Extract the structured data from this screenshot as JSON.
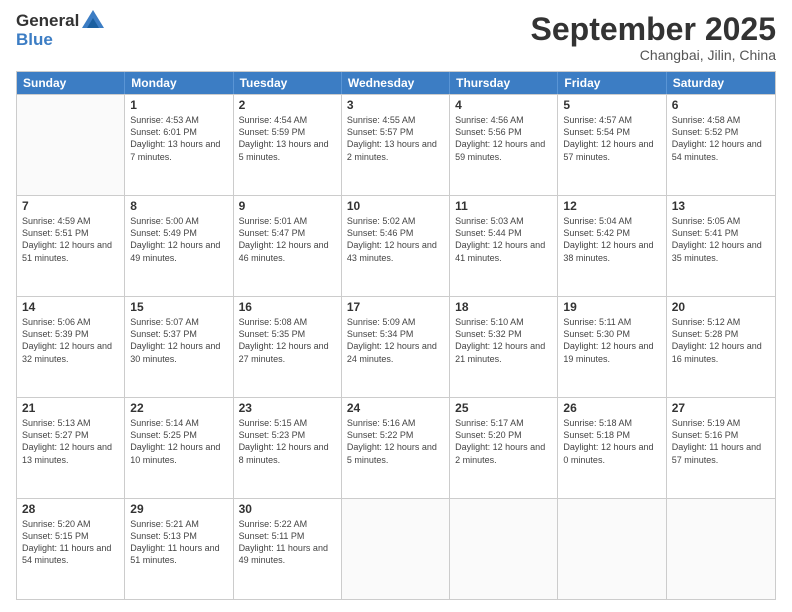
{
  "header": {
    "logo_general": "General",
    "logo_blue": "Blue",
    "month": "September 2025",
    "location": "Changbai, Jilin, China"
  },
  "days": [
    "Sunday",
    "Monday",
    "Tuesday",
    "Wednesday",
    "Thursday",
    "Friday",
    "Saturday"
  ],
  "weeks": [
    [
      {
        "day": "",
        "sunrise": "",
        "sunset": "",
        "daylight": ""
      },
      {
        "day": "1",
        "sunrise": "Sunrise: 4:53 AM",
        "sunset": "Sunset: 6:01 PM",
        "daylight": "Daylight: 13 hours and 7 minutes."
      },
      {
        "day": "2",
        "sunrise": "Sunrise: 4:54 AM",
        "sunset": "Sunset: 5:59 PM",
        "daylight": "Daylight: 13 hours and 5 minutes."
      },
      {
        "day": "3",
        "sunrise": "Sunrise: 4:55 AM",
        "sunset": "Sunset: 5:57 PM",
        "daylight": "Daylight: 13 hours and 2 minutes."
      },
      {
        "day": "4",
        "sunrise": "Sunrise: 4:56 AM",
        "sunset": "Sunset: 5:56 PM",
        "daylight": "Daylight: 12 hours and 59 minutes."
      },
      {
        "day": "5",
        "sunrise": "Sunrise: 4:57 AM",
        "sunset": "Sunset: 5:54 PM",
        "daylight": "Daylight: 12 hours and 57 minutes."
      },
      {
        "day": "6",
        "sunrise": "Sunrise: 4:58 AM",
        "sunset": "Sunset: 5:52 PM",
        "daylight": "Daylight: 12 hours and 54 minutes."
      }
    ],
    [
      {
        "day": "7",
        "sunrise": "Sunrise: 4:59 AM",
        "sunset": "Sunset: 5:51 PM",
        "daylight": "Daylight: 12 hours and 51 minutes."
      },
      {
        "day": "8",
        "sunrise": "Sunrise: 5:00 AM",
        "sunset": "Sunset: 5:49 PM",
        "daylight": "Daylight: 12 hours and 49 minutes."
      },
      {
        "day": "9",
        "sunrise": "Sunrise: 5:01 AM",
        "sunset": "Sunset: 5:47 PM",
        "daylight": "Daylight: 12 hours and 46 minutes."
      },
      {
        "day": "10",
        "sunrise": "Sunrise: 5:02 AM",
        "sunset": "Sunset: 5:46 PM",
        "daylight": "Daylight: 12 hours and 43 minutes."
      },
      {
        "day": "11",
        "sunrise": "Sunrise: 5:03 AM",
        "sunset": "Sunset: 5:44 PM",
        "daylight": "Daylight: 12 hours and 41 minutes."
      },
      {
        "day": "12",
        "sunrise": "Sunrise: 5:04 AM",
        "sunset": "Sunset: 5:42 PM",
        "daylight": "Daylight: 12 hours and 38 minutes."
      },
      {
        "day": "13",
        "sunrise": "Sunrise: 5:05 AM",
        "sunset": "Sunset: 5:41 PM",
        "daylight": "Daylight: 12 hours and 35 minutes."
      }
    ],
    [
      {
        "day": "14",
        "sunrise": "Sunrise: 5:06 AM",
        "sunset": "Sunset: 5:39 PM",
        "daylight": "Daylight: 12 hours and 32 minutes."
      },
      {
        "day": "15",
        "sunrise": "Sunrise: 5:07 AM",
        "sunset": "Sunset: 5:37 PM",
        "daylight": "Daylight: 12 hours and 30 minutes."
      },
      {
        "day": "16",
        "sunrise": "Sunrise: 5:08 AM",
        "sunset": "Sunset: 5:35 PM",
        "daylight": "Daylight: 12 hours and 27 minutes."
      },
      {
        "day": "17",
        "sunrise": "Sunrise: 5:09 AM",
        "sunset": "Sunset: 5:34 PM",
        "daylight": "Daylight: 12 hours and 24 minutes."
      },
      {
        "day": "18",
        "sunrise": "Sunrise: 5:10 AM",
        "sunset": "Sunset: 5:32 PM",
        "daylight": "Daylight: 12 hours and 21 minutes."
      },
      {
        "day": "19",
        "sunrise": "Sunrise: 5:11 AM",
        "sunset": "Sunset: 5:30 PM",
        "daylight": "Daylight: 12 hours and 19 minutes."
      },
      {
        "day": "20",
        "sunrise": "Sunrise: 5:12 AM",
        "sunset": "Sunset: 5:28 PM",
        "daylight": "Daylight: 12 hours and 16 minutes."
      }
    ],
    [
      {
        "day": "21",
        "sunrise": "Sunrise: 5:13 AM",
        "sunset": "Sunset: 5:27 PM",
        "daylight": "Daylight: 12 hours and 13 minutes."
      },
      {
        "day": "22",
        "sunrise": "Sunrise: 5:14 AM",
        "sunset": "Sunset: 5:25 PM",
        "daylight": "Daylight: 12 hours and 10 minutes."
      },
      {
        "day": "23",
        "sunrise": "Sunrise: 5:15 AM",
        "sunset": "Sunset: 5:23 PM",
        "daylight": "Daylight: 12 hours and 8 minutes."
      },
      {
        "day": "24",
        "sunrise": "Sunrise: 5:16 AM",
        "sunset": "Sunset: 5:22 PM",
        "daylight": "Daylight: 12 hours and 5 minutes."
      },
      {
        "day": "25",
        "sunrise": "Sunrise: 5:17 AM",
        "sunset": "Sunset: 5:20 PM",
        "daylight": "Daylight: 12 hours and 2 minutes."
      },
      {
        "day": "26",
        "sunrise": "Sunrise: 5:18 AM",
        "sunset": "Sunset: 5:18 PM",
        "daylight": "Daylight: 12 hours and 0 minutes."
      },
      {
        "day": "27",
        "sunrise": "Sunrise: 5:19 AM",
        "sunset": "Sunset: 5:16 PM",
        "daylight": "Daylight: 11 hours and 57 minutes."
      }
    ],
    [
      {
        "day": "28",
        "sunrise": "Sunrise: 5:20 AM",
        "sunset": "Sunset: 5:15 PM",
        "daylight": "Daylight: 11 hours and 54 minutes."
      },
      {
        "day": "29",
        "sunrise": "Sunrise: 5:21 AM",
        "sunset": "Sunset: 5:13 PM",
        "daylight": "Daylight: 11 hours and 51 minutes."
      },
      {
        "day": "30",
        "sunrise": "Sunrise: 5:22 AM",
        "sunset": "Sunset: 5:11 PM",
        "daylight": "Daylight: 11 hours and 49 minutes."
      },
      {
        "day": "",
        "sunrise": "",
        "sunset": "",
        "daylight": ""
      },
      {
        "day": "",
        "sunrise": "",
        "sunset": "",
        "daylight": ""
      },
      {
        "day": "",
        "sunrise": "",
        "sunset": "",
        "daylight": ""
      },
      {
        "day": "",
        "sunrise": "",
        "sunset": "",
        "daylight": ""
      }
    ]
  ]
}
